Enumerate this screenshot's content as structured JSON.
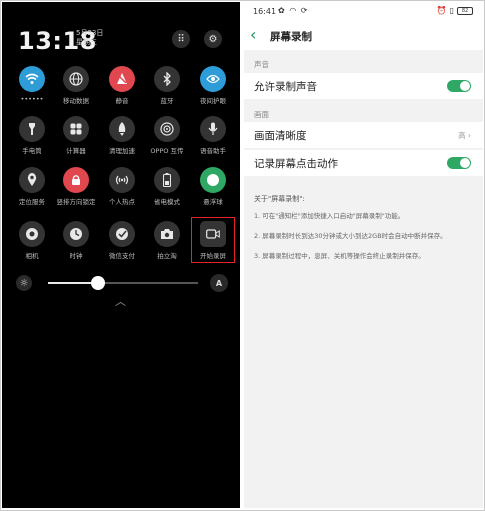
{
  "left": {
    "time": "13:18",
    "date_line1": "5月23日",
    "date_line2": "星期三",
    "top_buttons": [
      "grid-icon",
      "gear-icon"
    ],
    "tiles": [
      {
        "label": "••••••",
        "icon": "wifi-icon",
        "state": "on-blue"
      },
      {
        "label": "移动数据",
        "icon": "globe-icon",
        "state": "off"
      },
      {
        "label": "静音",
        "icon": "silent-icon",
        "state": "on-red"
      },
      {
        "label": "蓝牙",
        "icon": "bluetooth-icon",
        "state": "off"
      },
      {
        "label": "夜间护眼",
        "icon": "eye-icon",
        "state": "on-blue"
      },
      {
        "label": "手电筒",
        "icon": "flashlight-icon",
        "state": "off"
      },
      {
        "label": "计算器",
        "icon": "calculator-icon",
        "state": "off"
      },
      {
        "label": "清理加速",
        "icon": "rocket-icon",
        "state": "off"
      },
      {
        "label": "OPPO 互传",
        "icon": "share-icon",
        "state": "off"
      },
      {
        "label": "语音助手",
        "icon": "mic-icon",
        "state": "off"
      },
      {
        "label": "定位服务",
        "icon": "location-icon",
        "state": "off"
      },
      {
        "label": "竖排方向锁定",
        "icon": "rotation-lock-icon",
        "state": "on-red"
      },
      {
        "label": "个人热点",
        "icon": "hotspot-icon",
        "state": "off"
      },
      {
        "label": "省电模式",
        "icon": "battery-saver-icon",
        "state": "off"
      },
      {
        "label": "悬浮球",
        "icon": "float-ball-icon",
        "state": "on-green"
      },
      {
        "label": "相机",
        "icon": "camera-shutter-icon",
        "state": "off"
      },
      {
        "label": "时钟",
        "icon": "clock-icon",
        "state": "off"
      },
      {
        "label": "微信支付",
        "icon": "wechat-pay-icon",
        "state": "off"
      },
      {
        "label": "拍立淘",
        "icon": "photo-camera-icon",
        "state": "off"
      },
      {
        "label": "开始录屏",
        "icon": "screen-record-icon",
        "state": "off"
      }
    ],
    "brightness": 0.33,
    "auto_label": "A"
  },
  "right": {
    "status_time": "16:41",
    "battery": "82",
    "nav_title": "屏幕录制",
    "section_sound": "声音",
    "row_allow_sound": "允许录制声音",
    "section_picture": "画面",
    "row_clarity": "画面清晰度",
    "clarity_value": "高 ›",
    "row_record_touch": "记录屏幕点击动作",
    "about_title": "关于\"屏幕录制\":",
    "about_items": [
      "1. 可在\"通知栏\"添加快捷入口启动\"屏幕录制\"功能。",
      "2. 屏幕录制时长到达30分钟或大小到达2GB时会自动中断并保存。",
      "3. 屏幕录制过程中，息屏、关机等操作会终止录制并保存。"
    ],
    "colors": {
      "accent": "#2fa866",
      "back_arrow": "#1c8f5a"
    }
  }
}
